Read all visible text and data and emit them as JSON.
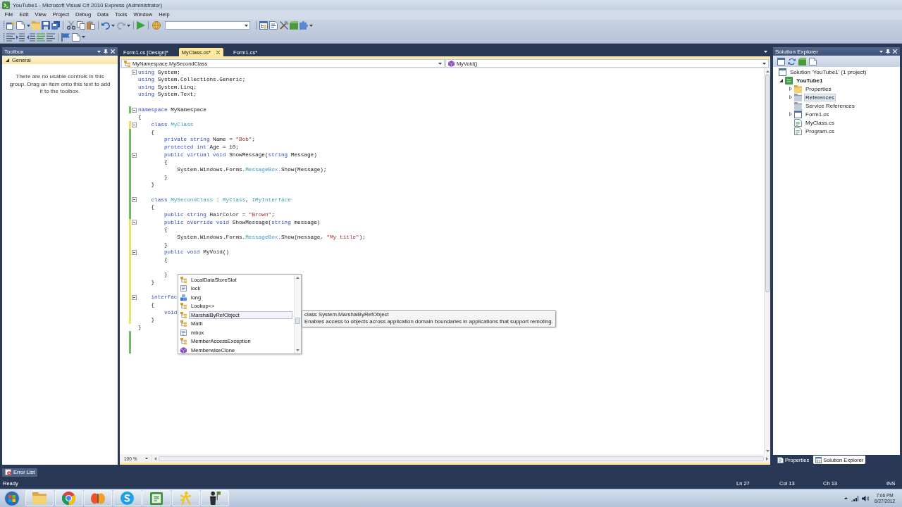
{
  "window": {
    "title": "YouTube1 - Microsoft Visual C# 2010 Express (Administrator)"
  },
  "menu": [
    "File",
    "Edit",
    "View",
    "Project",
    "Debug",
    "Data",
    "Tools",
    "Window",
    "Help"
  ],
  "toolbox": {
    "title": "Toolbox",
    "groups": [
      {
        "label": "General",
        "expanded": true
      }
    ],
    "message": "There are no usable controls in this group. Drag an item onto this text to add it to the toolbox."
  },
  "editor": {
    "tabs": [
      {
        "label": "Form1.cs [Design]*",
        "selected": false
      },
      {
        "label": "MyClass.cs*",
        "selected": true
      },
      {
        "label": "Form1.cs*",
        "selected": false
      }
    ],
    "type_selector": "MyNamespace.MySecondClass",
    "member_selector": "MyVoid()",
    "lines": [
      {
        "tokens": [
          {
            "kind": "keyword",
            "text": "using"
          },
          {
            "kind": "plain",
            "text": " System;"
          }
        ],
        "fold": true
      },
      {
        "tokens": [
          {
            "kind": "keyword",
            "text": "using"
          },
          {
            "kind": "plain",
            "text": " System.Collections.Generic;"
          }
        ],
        "fold": false
      },
      {
        "tokens": [
          {
            "kind": "keyword",
            "text": "using"
          },
          {
            "kind": "plain",
            "text": " System.Linq;"
          }
        ],
        "fold": false
      },
      {
        "tokens": [
          {
            "kind": "keyword",
            "text": "using"
          },
          {
            "kind": "plain",
            "text": " System.Text;"
          }
        ],
        "fold": false
      },
      {
        "fold": false
      },
      {
        "tokens": [
          {
            "kind": "keyword",
            "text": "namespace"
          },
          {
            "kind": "plain",
            "text": " MyNamespace"
          }
        ],
        "fold": true,
        "color": "#6cbf5c"
      },
      {
        "tokens": [
          {
            "kind": "plain",
            "text": "{"
          }
        ],
        "fold": false
      },
      {
        "tokens": [
          {
            "kind": "keyword",
            "text": "    class"
          },
          {
            "kind": "type",
            "text": " MyClass"
          }
        ],
        "fold": true,
        "color": "#ece26a"
      },
      {
        "tokens": [
          {
            "kind": "plain",
            "text": "    {"
          }
        ],
        "fold": false,
        "color": "#6cbf5c"
      },
      {
        "tokens": [
          {
            "kind": "keyword",
            "text": "        private string"
          },
          {
            "kind": "plain",
            "text": " Name = "
          },
          {
            "kind": "string",
            "text": "\"Bob\""
          },
          {
            "kind": "plain",
            "text": ";"
          }
        ],
        "fold": false,
        "color": "#6cbf5c"
      },
      {
        "tokens": [
          {
            "kind": "keyword",
            "text": "        protected int"
          },
          {
            "kind": "plain",
            "text": " Age = 10;"
          }
        ],
        "fold": false,
        "color": "#6cbf5c"
      },
      {
        "tokens": [
          {
            "kind": "keyword",
            "text": "        public virtual void"
          },
          {
            "kind": "plain",
            "text": " ShowMessage("
          },
          {
            "kind": "keyword",
            "text": "string"
          },
          {
            "kind": "plain",
            "text": " Message)"
          }
        ],
        "fold": true,
        "color": "#6cbf5c"
      },
      {
        "tokens": [
          {
            "kind": "plain",
            "text": "        {"
          }
        ],
        "fold": false,
        "color": "#6cbf5c"
      },
      {
        "tokens": [
          {
            "kind": "plain",
            "text": "            System.Windows.Forms."
          },
          {
            "kind": "type",
            "text": "MessageBox"
          },
          {
            "kind": "plain",
            "text": ".Show(Message);"
          }
        ],
        "fold": false,
        "color": "#6cbf5c"
      },
      {
        "tokens": [
          {
            "kind": "plain",
            "text": "        }"
          }
        ],
        "fold": false,
        "color": "#6cbf5c"
      },
      {
        "tokens": [
          {
            "kind": "plain",
            "text": "    }"
          }
        ],
        "fold": false,
        "color": "#6cbf5c"
      },
      {
        "fold": false,
        "color": "#6cbf5c"
      },
      {
        "tokens": [
          {
            "kind": "keyword",
            "text": "    class"
          },
          {
            "kind": "type",
            "text": " MySecondClass"
          },
          {
            "kind": "plain",
            "text": " : "
          },
          {
            "kind": "type",
            "text": "MyClass"
          },
          {
            "kind": "plain",
            "text": ", "
          },
          {
            "kind": "type",
            "text": "IMyInterface"
          }
        ],
        "fold": true,
        "color": "#6cbf5c"
      },
      {
        "tokens": [
          {
            "kind": "plain",
            "text": "    {"
          }
        ],
        "fold": false,
        "color": "#6cbf5c"
      },
      {
        "tokens": [
          {
            "kind": "keyword",
            "text": "        public string"
          },
          {
            "kind": "plain",
            "text": " HairColor = "
          },
          {
            "kind": "string",
            "text": "\"Brown\""
          },
          {
            "kind": "plain",
            "text": ";"
          }
        ],
        "fold": false,
        "color": "#6cbf5c"
      },
      {
        "tokens": [
          {
            "kind": "keyword",
            "text": "        public override void"
          },
          {
            "kind": "plain",
            "text": " ShowMessage("
          },
          {
            "kind": "keyword",
            "text": "string"
          },
          {
            "kind": "plain",
            "text": " message)"
          }
        ],
        "fold": true,
        "color": "#ece26a"
      },
      {
        "tokens": [
          {
            "kind": "plain",
            "text": "        {"
          }
        ],
        "fold": false,
        "color": "#ece26a"
      },
      {
        "tokens": [
          {
            "kind": "plain",
            "text": "            System.Windows.Forms."
          },
          {
            "kind": "type",
            "text": "MessageBox"
          },
          {
            "kind": "plain",
            "text": ".Show(message, "
          },
          {
            "kind": "string",
            "text": "\"My title\""
          },
          {
            "kind": "plain",
            "text": ");"
          }
        ],
        "fold": false,
        "color": "#ece26a"
      },
      {
        "tokens": [
          {
            "kind": "plain",
            "text": "        }"
          }
        ],
        "fold": false,
        "color": "#ece26a"
      },
      {
        "tokens": [
          {
            "kind": "keyword",
            "text": "        public void"
          },
          {
            "kind": "plain",
            "text": " MyVoid()"
          }
        ],
        "fold": true,
        "color": "#ece26a"
      },
      {
        "tokens": [
          {
            "kind": "plain",
            "text": "        {"
          }
        ],
        "fold": false,
        "color": "#ece26a"
      },
      {
        "fold": false,
        "color": "#ece26a"
      },
      {
        "tokens": [
          {
            "kind": "plain",
            "text": "        }"
          }
        ],
        "fold": false,
        "color": "#ece26a"
      },
      {
        "tokens": [
          {
            "kind": "plain",
            "text": "    }"
          }
        ],
        "fold": false,
        "color": "#ece26a"
      },
      {
        "fold": false,
        "color": "#ece26a"
      },
      {
        "tokens": [
          {
            "kind": "keyword",
            "text": "    interfac"
          }
        ],
        "fold": true,
        "color": "#ece26a"
      },
      {
        "tokens": [
          {
            "kind": "plain",
            "text": "    {"
          }
        ],
        "fold": false,
        "color": "#ece26a"
      },
      {
        "tokens": [
          {
            "kind": "keyword",
            "text": "        void"
          }
        ],
        "fold": false,
        "color": "#ece26a"
      },
      {
        "tokens": [
          {
            "kind": "plain",
            "text": "    }"
          }
        ],
        "fold": false,
        "color": "#ece26a"
      },
      {
        "tokens": [
          {
            "kind": "plain",
            "text": "}"
          }
        ],
        "fold": false
      },
      {
        "fold": false,
        "color": "#6cbf5c"
      },
      {
        "fold": false,
        "color": "#6cbf5c"
      },
      {
        "fold": false,
        "color": "#6cbf5c"
      }
    ],
    "zoom": "100 %"
  },
  "completion": {
    "items": [
      {
        "label": "LocalDataStoreSlot",
        "kind": "class",
        "selected": false
      },
      {
        "label": "lock",
        "kind": "snippet",
        "selected": false
      },
      {
        "label": "long",
        "kind": "struct",
        "selected": false
      },
      {
        "label": "Lookup<>",
        "kind": "class",
        "selected": false
      },
      {
        "label": "MarshalByRefObject",
        "kind": "class",
        "selected": true
      },
      {
        "label": "Math",
        "kind": "class",
        "selected": false
      },
      {
        "label": "mbox",
        "kind": "snippet",
        "selected": false
      },
      {
        "label": "MemberAccessException",
        "kind": "class",
        "selected": false
      },
      {
        "label": "MemberwiseClone",
        "kind": "method",
        "selected": false
      }
    ],
    "tooltip": {
      "signature": "class System.MarshalByRefObject",
      "description": "Enables access to objects across application domain boundaries in applications that support remoting."
    }
  },
  "solution_explorer": {
    "title": "Solution Explorer",
    "tree": [
      {
        "label": "Solution 'YouTube1' (1 project)",
        "kind": "solution",
        "selected": false,
        "children": [
          {
            "label": "YouTube1",
            "kind": "project",
            "expanded": true,
            "selected": false,
            "children": [
              {
                "label": "Properties",
                "kind": "folder",
                "expanded": false,
                "selected": false
              },
              {
                "label": "References",
                "kind": "references",
                "expanded": false,
                "selected": true
              },
              {
                "label": "Service References",
                "kind": "references",
                "selected": false
              },
              {
                "label": "Form1.cs",
                "kind": "form",
                "expanded": false,
                "selected": false
              },
              {
                "label": "MyClass.cs",
                "kind": "code",
                "selected": false
              },
              {
                "label": "Program.cs",
                "kind": "code",
                "selected": false
              }
            ]
          }
        ]
      }
    ],
    "tabs": [
      {
        "label": "Properties",
        "kind": "properties",
        "selected": false
      },
      {
        "label": "Solution Explorer",
        "kind": "solution",
        "selected": true
      }
    ]
  },
  "error_list_tab": "Error List",
  "status_bar": {
    "message": "Ready",
    "line": "Ln 27",
    "column": "Col 13",
    "char": "Ch 13",
    "mode": "INS"
  },
  "taskbar": {
    "time": "7:06 PM",
    "date": "6/27/2012"
  }
}
